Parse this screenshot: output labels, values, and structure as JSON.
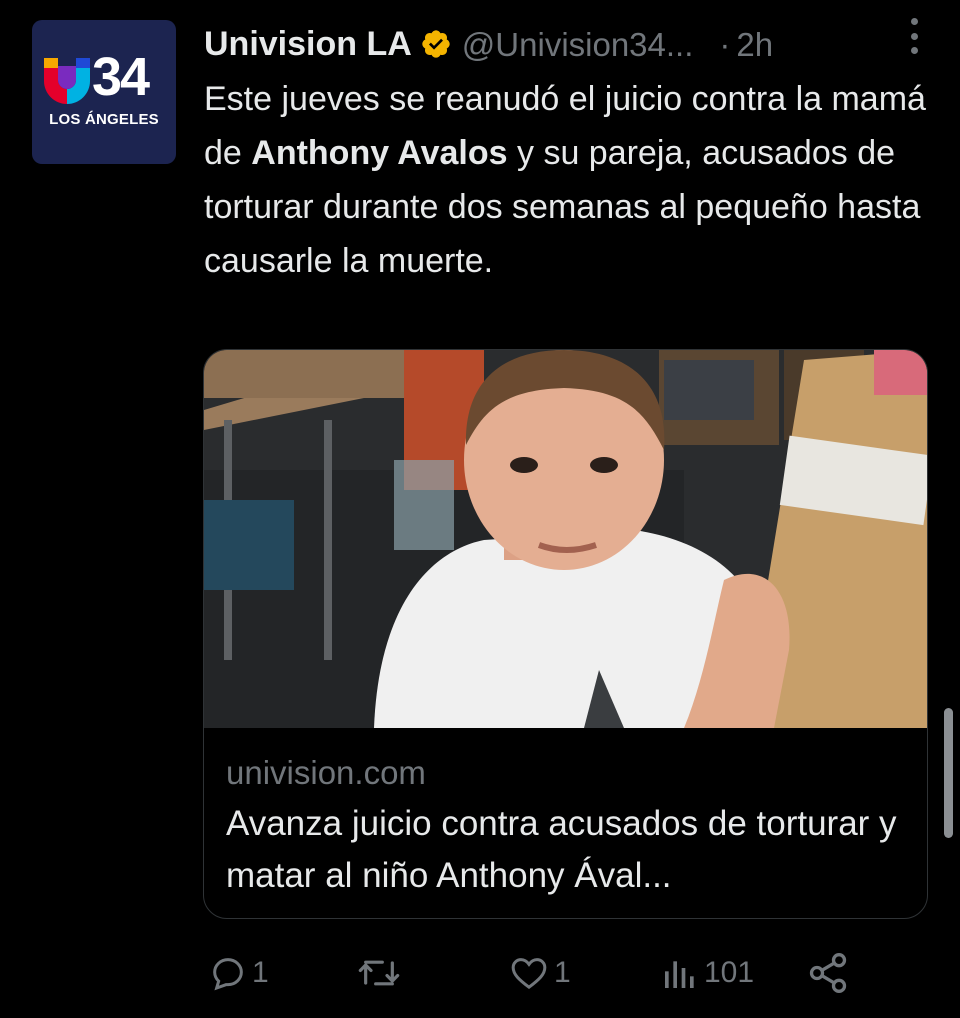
{
  "author": {
    "display_name": "Univision LA",
    "handle": "@Univision34...",
    "separator": "·",
    "time": "2h",
    "verified": true,
    "verified_color": "#f4b400",
    "avatar": {
      "logo_number": "34",
      "logo_subtitle": "LOS ÁNGELES",
      "background": "#1c2450"
    }
  },
  "tweet": {
    "text_before": "Este jueves se reanudó el juicio contra la mamá de ",
    "text_bold": "Anthony Avalos",
    "text_after": " y su pareja, acusados de torturar durante dos semanas al pequeño hasta causarle la muerte."
  },
  "card": {
    "image_icon": "photo-of-child-in-classroom",
    "domain": "univision.com",
    "title": "Avanza juicio contra acusados de torturar y matar al niño Anthony Ával..."
  },
  "actions": {
    "reply_count": "1",
    "retweet_count": "",
    "like_count": "1",
    "views_count": "101"
  },
  "colors": {
    "background": "#000000",
    "text_primary": "#e7e9ea",
    "text_secondary": "#71767b",
    "border": "#2f3336"
  }
}
